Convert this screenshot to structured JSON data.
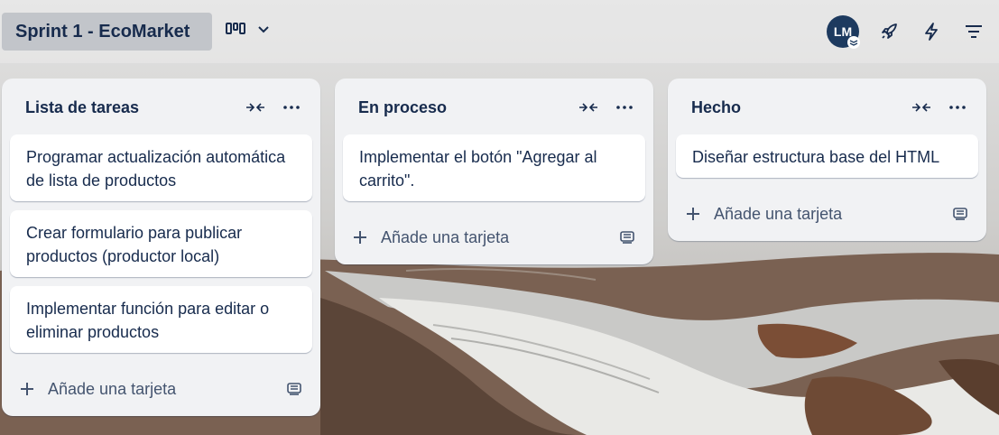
{
  "board": {
    "title": "Sprint 1 - EcoMarket",
    "avatar_initials": "LM"
  },
  "icons": {
    "view_switch": "board-view-icon",
    "dropdown": "chevron-down-icon",
    "power_ups": "rocket-icon",
    "automation": "lightning-icon",
    "filter": "filter-icon",
    "collapse": "collapse-icon",
    "more": "more-dots-icon",
    "add": "plus-icon",
    "template": "card-template-icon"
  },
  "lists": [
    {
      "title": "Lista de tareas",
      "cards": [
        "Programar actualización automática de lista de productos",
        "Crear formulario para publicar productos (productor local)",
        "Implementar función para editar o eliminar productos"
      ],
      "add_label": "Añade una tarjeta"
    },
    {
      "title": "En proceso",
      "cards": [
        "Implementar el botón \"Agregar al carrito\"."
      ],
      "add_label": "Añade una tarjeta"
    },
    {
      "title": "Hecho",
      "cards": [
        "Diseñar estructura base del HTML"
      ],
      "add_label": "Añade una tarjeta"
    }
  ],
  "colors": {
    "text_dark": "#172b4d",
    "avatar_bg": "#1d3a5f",
    "list_bg": "#f1f2f4"
  }
}
